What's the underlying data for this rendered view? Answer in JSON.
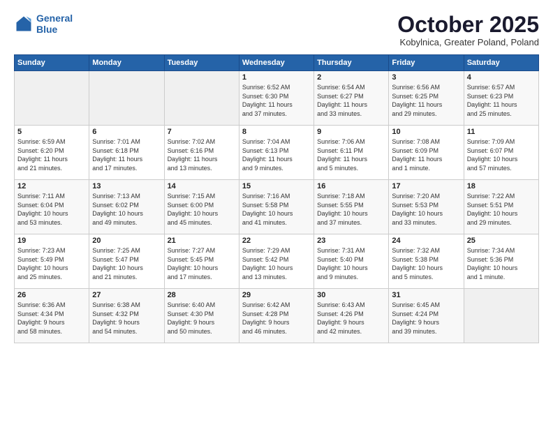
{
  "header": {
    "logo_line1": "General",
    "logo_line2": "Blue",
    "month": "October 2025",
    "location": "Kobylnica, Greater Poland, Poland"
  },
  "weekdays": [
    "Sunday",
    "Monday",
    "Tuesday",
    "Wednesday",
    "Thursday",
    "Friday",
    "Saturday"
  ],
  "weeks": [
    [
      {
        "day": "",
        "content": ""
      },
      {
        "day": "",
        "content": ""
      },
      {
        "day": "",
        "content": ""
      },
      {
        "day": "1",
        "content": "Sunrise: 6:52 AM\nSunset: 6:30 PM\nDaylight: 11 hours\nand 37 minutes."
      },
      {
        "day": "2",
        "content": "Sunrise: 6:54 AM\nSunset: 6:27 PM\nDaylight: 11 hours\nand 33 minutes."
      },
      {
        "day": "3",
        "content": "Sunrise: 6:56 AM\nSunset: 6:25 PM\nDaylight: 11 hours\nand 29 minutes."
      },
      {
        "day": "4",
        "content": "Sunrise: 6:57 AM\nSunset: 6:23 PM\nDaylight: 11 hours\nand 25 minutes."
      }
    ],
    [
      {
        "day": "5",
        "content": "Sunrise: 6:59 AM\nSunset: 6:20 PM\nDaylight: 11 hours\nand 21 minutes."
      },
      {
        "day": "6",
        "content": "Sunrise: 7:01 AM\nSunset: 6:18 PM\nDaylight: 11 hours\nand 17 minutes."
      },
      {
        "day": "7",
        "content": "Sunrise: 7:02 AM\nSunset: 6:16 PM\nDaylight: 11 hours\nand 13 minutes."
      },
      {
        "day": "8",
        "content": "Sunrise: 7:04 AM\nSunset: 6:13 PM\nDaylight: 11 hours\nand 9 minutes."
      },
      {
        "day": "9",
        "content": "Sunrise: 7:06 AM\nSunset: 6:11 PM\nDaylight: 11 hours\nand 5 minutes."
      },
      {
        "day": "10",
        "content": "Sunrise: 7:08 AM\nSunset: 6:09 PM\nDaylight: 11 hours\nand 1 minute."
      },
      {
        "day": "11",
        "content": "Sunrise: 7:09 AM\nSunset: 6:07 PM\nDaylight: 10 hours\nand 57 minutes."
      }
    ],
    [
      {
        "day": "12",
        "content": "Sunrise: 7:11 AM\nSunset: 6:04 PM\nDaylight: 10 hours\nand 53 minutes."
      },
      {
        "day": "13",
        "content": "Sunrise: 7:13 AM\nSunset: 6:02 PM\nDaylight: 10 hours\nand 49 minutes."
      },
      {
        "day": "14",
        "content": "Sunrise: 7:15 AM\nSunset: 6:00 PM\nDaylight: 10 hours\nand 45 minutes."
      },
      {
        "day": "15",
        "content": "Sunrise: 7:16 AM\nSunset: 5:58 PM\nDaylight: 10 hours\nand 41 minutes."
      },
      {
        "day": "16",
        "content": "Sunrise: 7:18 AM\nSunset: 5:55 PM\nDaylight: 10 hours\nand 37 minutes."
      },
      {
        "day": "17",
        "content": "Sunrise: 7:20 AM\nSunset: 5:53 PM\nDaylight: 10 hours\nand 33 minutes."
      },
      {
        "day": "18",
        "content": "Sunrise: 7:22 AM\nSunset: 5:51 PM\nDaylight: 10 hours\nand 29 minutes."
      }
    ],
    [
      {
        "day": "19",
        "content": "Sunrise: 7:23 AM\nSunset: 5:49 PM\nDaylight: 10 hours\nand 25 minutes."
      },
      {
        "day": "20",
        "content": "Sunrise: 7:25 AM\nSunset: 5:47 PM\nDaylight: 10 hours\nand 21 minutes."
      },
      {
        "day": "21",
        "content": "Sunrise: 7:27 AM\nSunset: 5:45 PM\nDaylight: 10 hours\nand 17 minutes."
      },
      {
        "day": "22",
        "content": "Sunrise: 7:29 AM\nSunset: 5:42 PM\nDaylight: 10 hours\nand 13 minutes."
      },
      {
        "day": "23",
        "content": "Sunrise: 7:31 AM\nSunset: 5:40 PM\nDaylight: 10 hours\nand 9 minutes."
      },
      {
        "day": "24",
        "content": "Sunrise: 7:32 AM\nSunset: 5:38 PM\nDaylight: 10 hours\nand 5 minutes."
      },
      {
        "day": "25",
        "content": "Sunrise: 7:34 AM\nSunset: 5:36 PM\nDaylight: 10 hours\nand 1 minute."
      }
    ],
    [
      {
        "day": "26",
        "content": "Sunrise: 6:36 AM\nSunset: 4:34 PM\nDaylight: 9 hours\nand 58 minutes."
      },
      {
        "day": "27",
        "content": "Sunrise: 6:38 AM\nSunset: 4:32 PM\nDaylight: 9 hours\nand 54 minutes."
      },
      {
        "day": "28",
        "content": "Sunrise: 6:40 AM\nSunset: 4:30 PM\nDaylight: 9 hours\nand 50 minutes."
      },
      {
        "day": "29",
        "content": "Sunrise: 6:42 AM\nSunset: 4:28 PM\nDaylight: 9 hours\nand 46 minutes."
      },
      {
        "day": "30",
        "content": "Sunrise: 6:43 AM\nSunset: 4:26 PM\nDaylight: 9 hours\nand 42 minutes."
      },
      {
        "day": "31",
        "content": "Sunrise: 6:45 AM\nSunset: 4:24 PM\nDaylight: 9 hours\nand 39 minutes."
      },
      {
        "day": "",
        "content": ""
      }
    ]
  ]
}
